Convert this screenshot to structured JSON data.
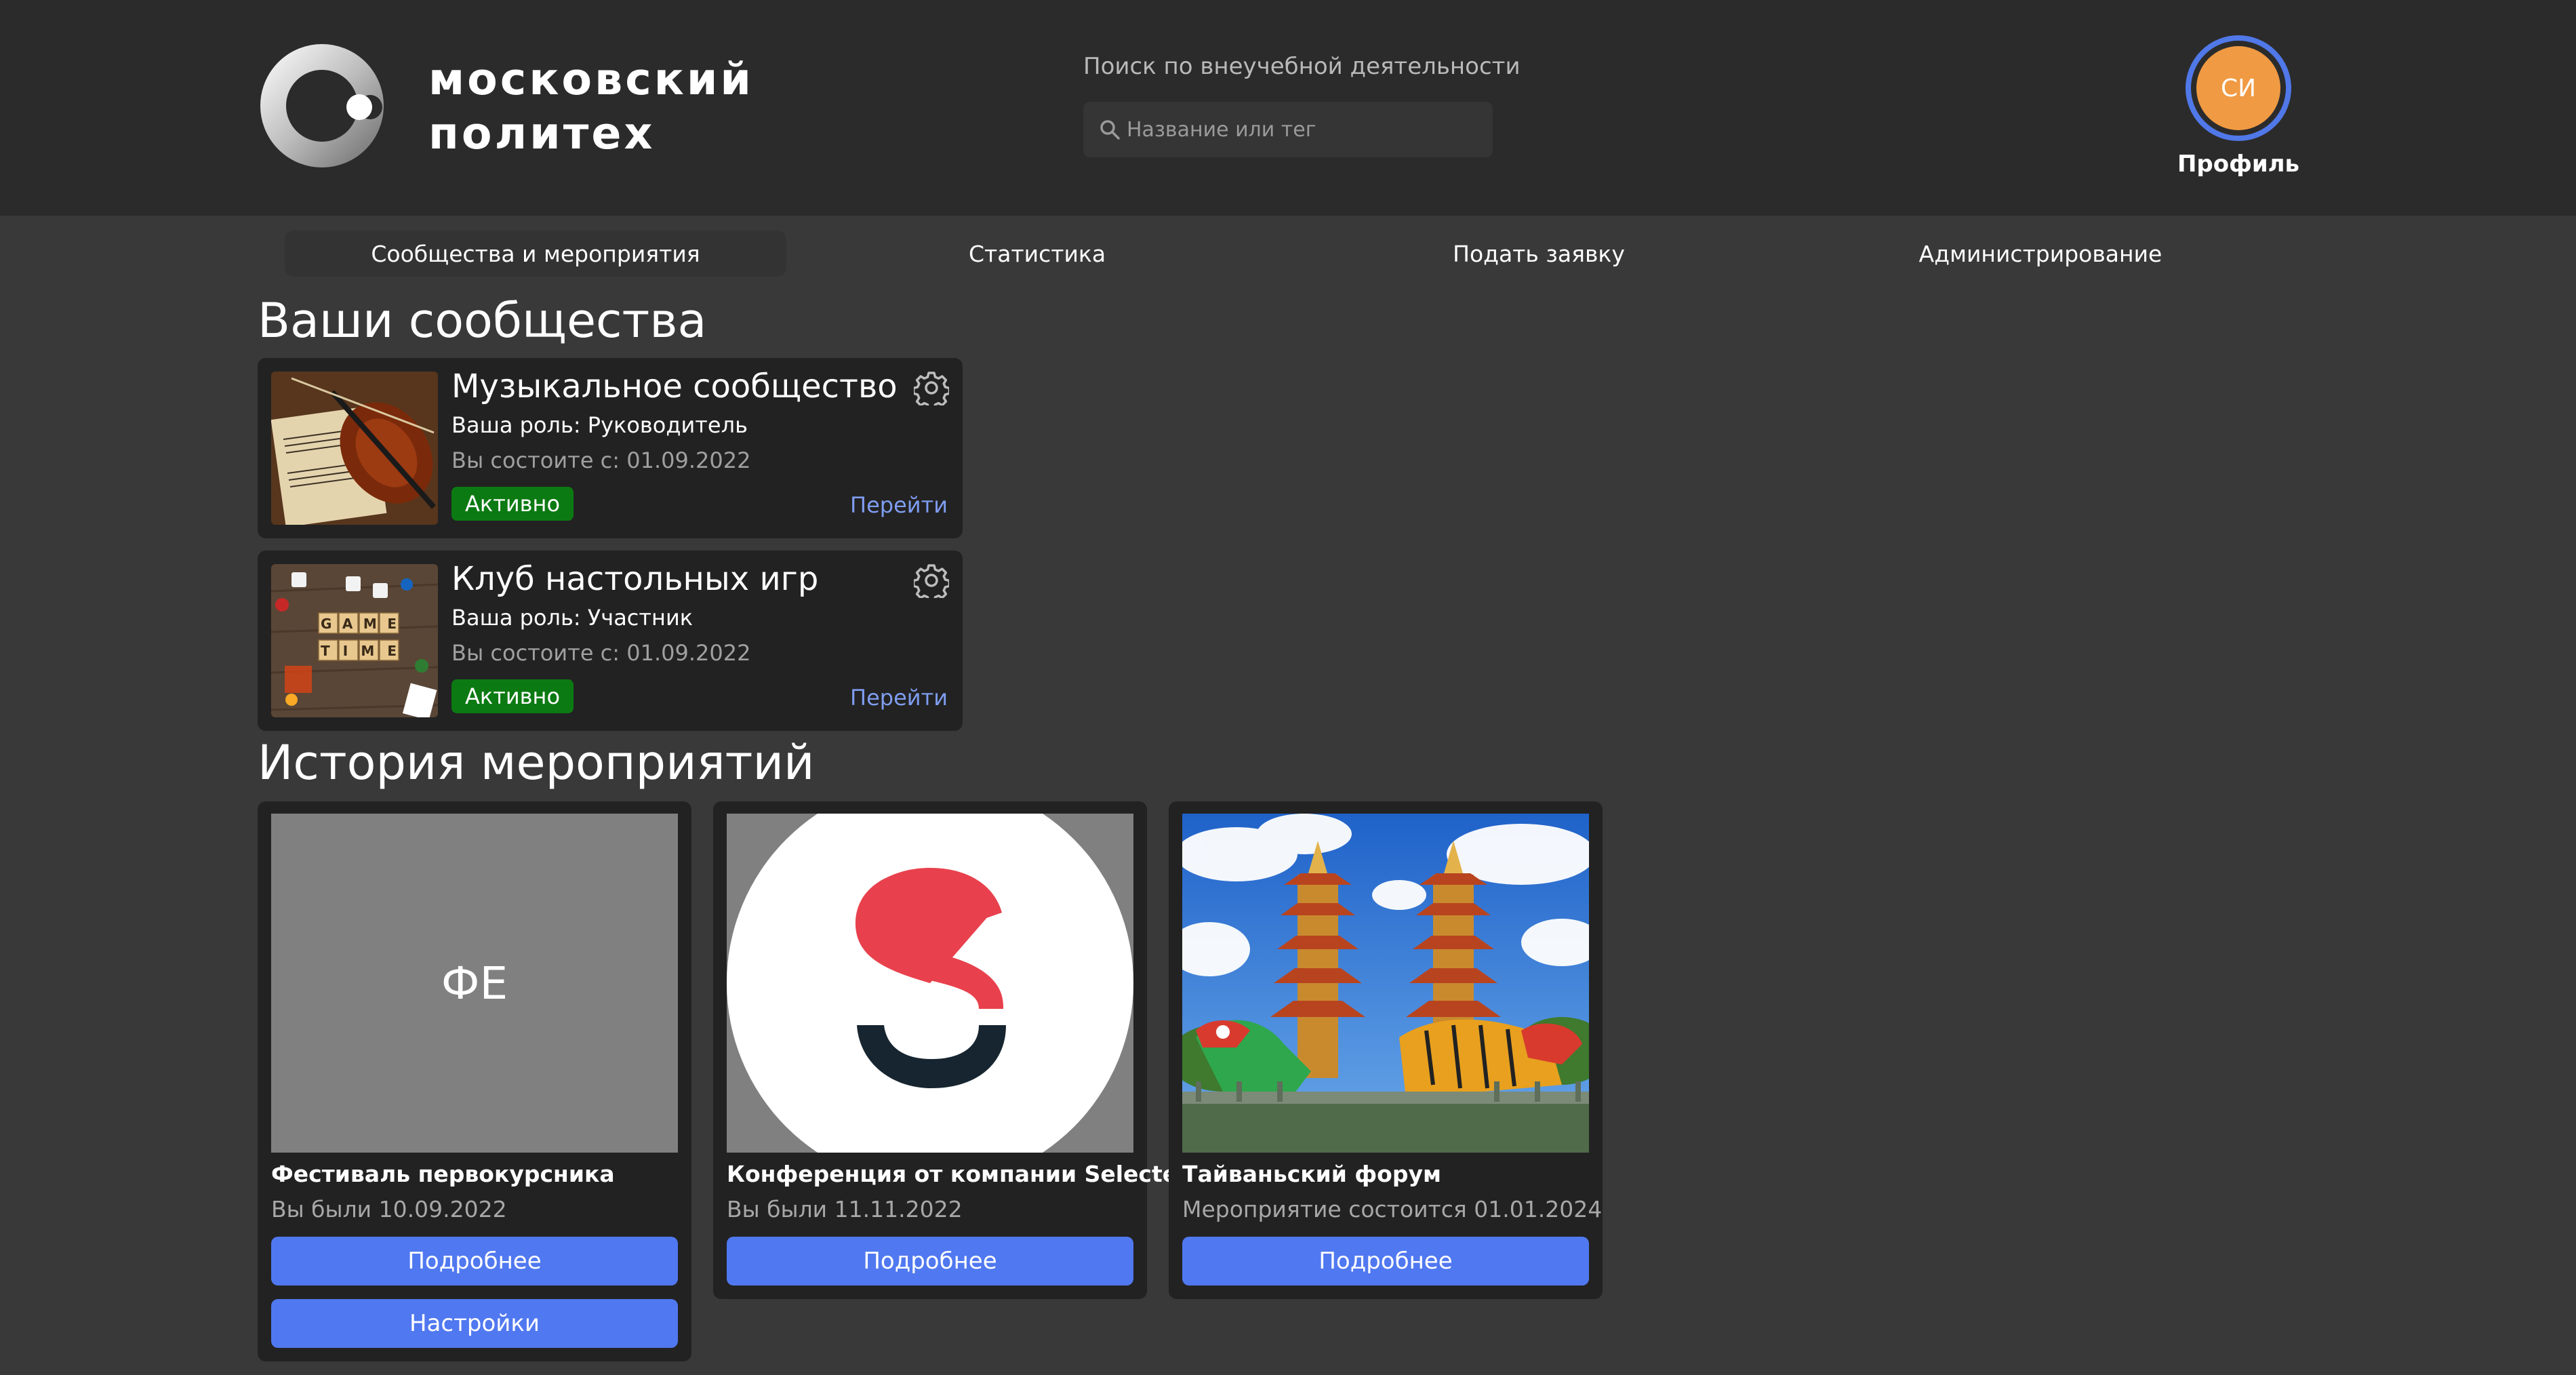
{
  "header": {
    "logo_line1": "московский",
    "logo_line2": "политех",
    "search_label": "Поиск по внеучебной деятельности",
    "search_placeholder": "Название или тег",
    "profile_initials": "СИ",
    "profile_label": "Профиль"
  },
  "nav": {
    "tabs": [
      {
        "label": "Сообщества и мероприятия",
        "active": true
      },
      {
        "label": "Статистика"
      },
      {
        "label": "Подать заявку"
      },
      {
        "label": "Администрирование"
      }
    ]
  },
  "communities": {
    "title": "Ваши сообщества",
    "items": [
      {
        "name": "Музыкальное сообщество",
        "role": "Ваша роль: Руководитель",
        "since": "Вы состоите с: 01.09.2022",
        "status": "Активно",
        "link": "Перейти"
      },
      {
        "name": "Клуб настольных игр",
        "role": "Ваша роль: Участник",
        "since": "Вы состоите с: 01.09.2022",
        "status": "Активно",
        "link": "Перейти",
        "image_text": [
          "GAME",
          "TIME"
        ]
      }
    ]
  },
  "events": {
    "title": "История мероприятий",
    "items": [
      {
        "initials": "ФЕ",
        "title": "Фестиваль первокурсника",
        "date": "Вы были 10.09.2022",
        "details_button": "Подробнее",
        "settings_button": "Настройки"
      },
      {
        "logo_letter": "S",
        "title": "Конференция от компании Selectel",
        "date": "Вы были 11.11.2022",
        "details_button": "Подробнее"
      },
      {
        "title": "Тайваньский форум",
        "date": "Мероприятие состоится 01.01.2024",
        "details_button": "Подробнее"
      }
    ]
  },
  "colors": {
    "background": "#393939",
    "header": "#2b2b2b",
    "card": "#222222",
    "accent_button": "#5078f0",
    "status_active": "#0c7a12",
    "link": "#7f9df0",
    "avatar": "#f09a43",
    "avatar_ring": "#5078e8",
    "selectel_red": "#e8414d",
    "selectel_dark": "#16252f"
  },
  "icons": {
    "logo": "polytech-ring-logo",
    "search": "search-icon",
    "settings": "gear-icon"
  }
}
